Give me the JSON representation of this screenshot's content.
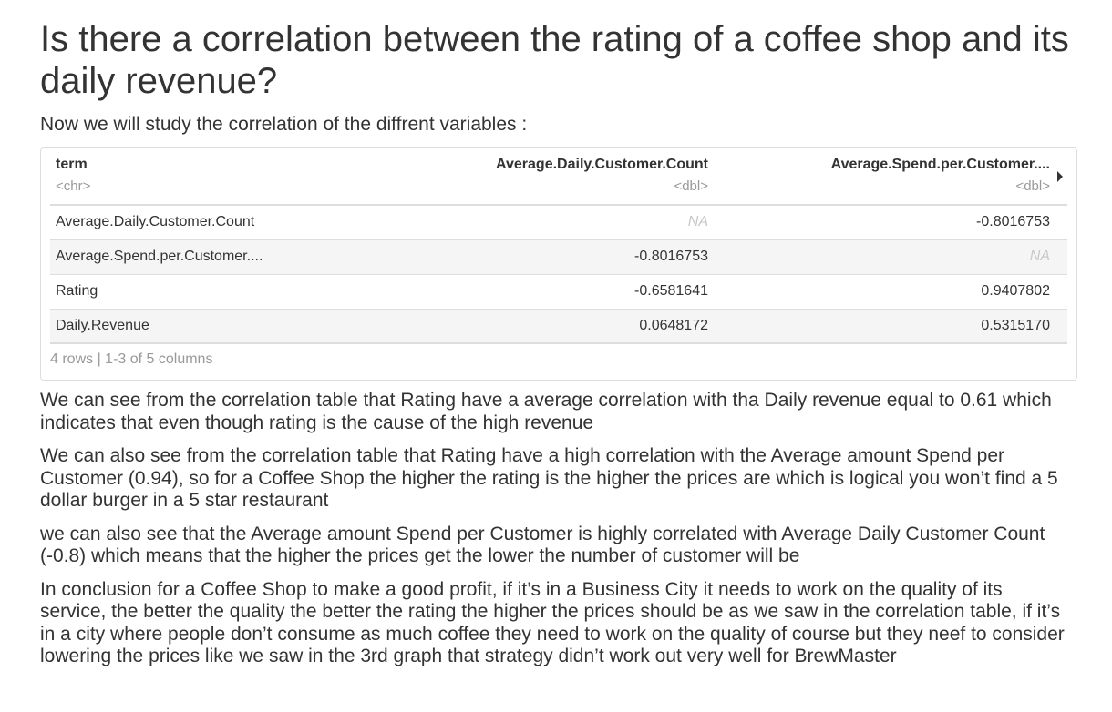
{
  "heading": "Is there a correlation between the rating of a coffee shop and its daily revenue?",
  "intro": "Now we will study the correlation of the diffrent variables :",
  "table": {
    "columns": [
      {
        "name": "term",
        "type": "<chr>"
      },
      {
        "name": "Average.Daily.Customer.Count",
        "type": "<dbl>"
      },
      {
        "name": "Average.Spend.per.Customer....",
        "type": "<dbl>"
      }
    ],
    "rows": [
      {
        "term": "Average.Daily.Customer.Count",
        "c1": "NA",
        "c2": "-0.8016753"
      },
      {
        "term": "Average.Spend.per.Customer....",
        "c1": "-0.8016753",
        "c2": "NA"
      },
      {
        "term": "Rating",
        "c1": "-0.6581641",
        "c2": "0.9407802"
      },
      {
        "term": "Daily.Revenue",
        "c1": "0.0648172",
        "c2": "0.5315170"
      }
    ],
    "footer": "4 rows | 1-3 of 5 columns"
  },
  "paragraphs": [
    "We can see from the correlation table that Rating have a average correlation with tha Daily revenue equal to 0.61 which indicates that even though rating is the cause of the high revenue",
    "We can also see from the correlation table that Rating have a high correlation with the Average amount Spend per Customer (0.94), so for a Coffee Shop the higher the rating is the higher the prices are which is logical you won’t find a 5 dollar burger in a 5 star restaurant",
    "we can also see that the Average amount Spend per Customer is highly correlated with Average Daily Customer Count (-0.8) which means that the higher the prices get the lower the number of customer will be",
    "In conclusion for a Coffee Shop to make a good profit, if it’s in a Business City it needs to work on the quality of its service, the better the quality the better the rating the higher the prices should be as we saw in the correlation table, if it’s in a city where people don’t consume as much coffee they need to work on the quality of course but they neef to consider lowering the prices like we saw in the 3rd graph that strategy didn’t work out very well for BrewMaster"
  ]
}
